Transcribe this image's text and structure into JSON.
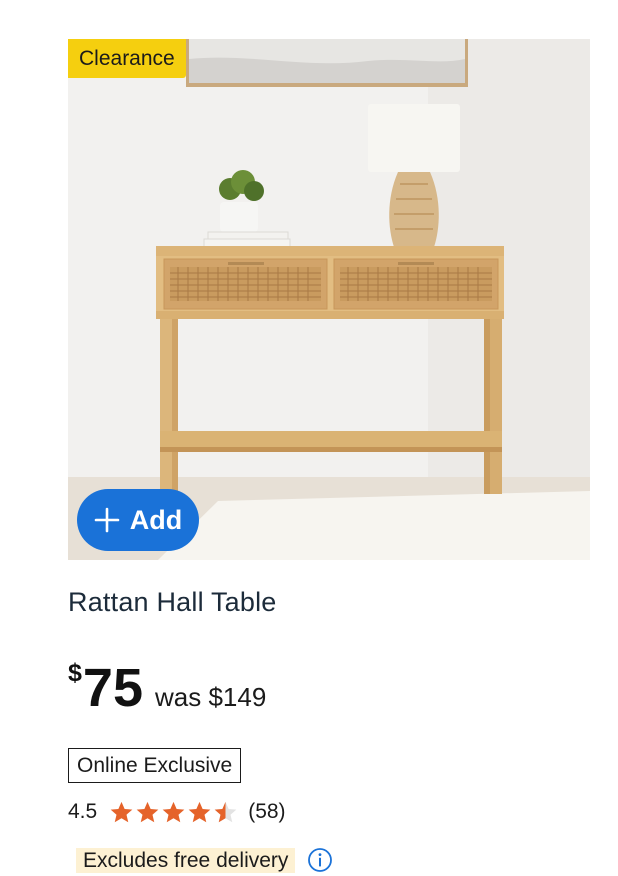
{
  "product": {
    "badge": "Clearance",
    "add_label": "Add",
    "title": "Rattan Hall Table",
    "currency_symbol": "$",
    "price": "75",
    "was_price": "was $149",
    "exclusive_tag": "Online Exclusive",
    "rating": 4.5,
    "rating_text": "4.5",
    "review_count": "(58)",
    "delivery_note": "Excludes free delivery",
    "star_color": "#e5632a",
    "badge_color": "#f5cf0f",
    "add_button_color": "#1a72d8",
    "image_alt": "product-photo"
  }
}
